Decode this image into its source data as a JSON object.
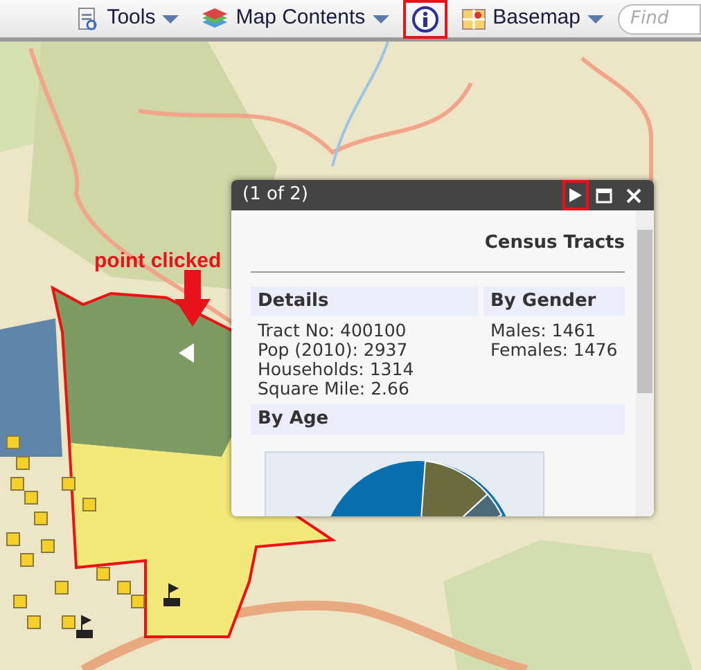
{
  "toolbar": {
    "items": [
      {
        "kind": "menu",
        "label": "Tools",
        "highlighted": false
      },
      {
        "kind": "menu",
        "label": "Map Contents",
        "highlighted": false
      },
      {
        "kind": "info",
        "highlighted": true
      },
      {
        "kind": "menu",
        "label": "Basemap",
        "highlighted": false
      }
    ],
    "search": {
      "placeholder": "Find"
    }
  },
  "map": {
    "annotation": "point clicked"
  },
  "popup": {
    "title": "(1 of 2)",
    "next_highlighted": true,
    "layer": "Census Tracts",
    "sections": [
      {
        "heading": "Details",
        "lines": [
          "Tract No: 400100",
          "Pop (2010): 2937",
          "Households: 1314",
          "Square Mile: 2.66"
        ]
      },
      {
        "heading": "By Gender",
        "lines": [
          "Males: 1461",
          "Females: 1476"
        ]
      }
    ],
    "chart_section": {
      "heading": "By Age"
    }
  }
}
